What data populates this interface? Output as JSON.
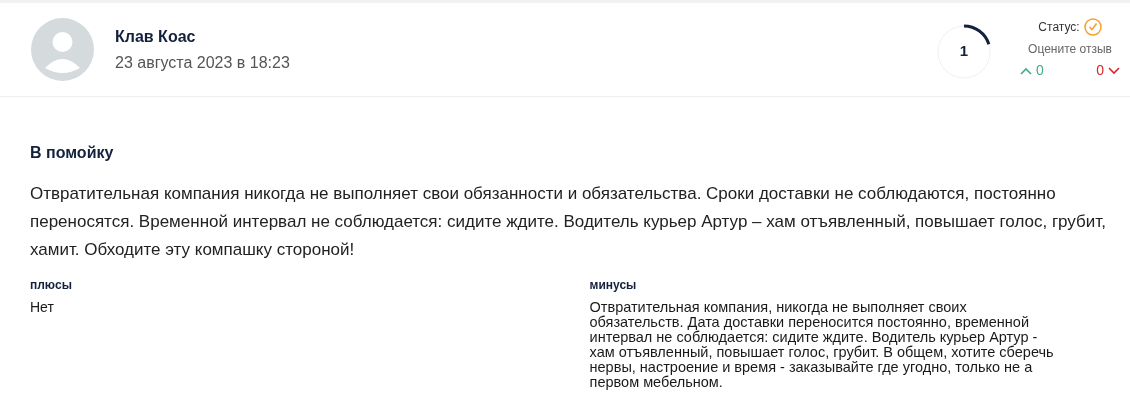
{
  "author": {
    "name": "Клав Коас",
    "date": "23 августа 2023 в 18:23"
  },
  "rating": {
    "value": "1",
    "level": 0.2
  },
  "status": {
    "label": "Статус:",
    "verified": true
  },
  "vote": {
    "prompt": "Оцените отзыв",
    "likes": "0",
    "dislikes": "0"
  },
  "review": {
    "title": "В помойку",
    "text": "Отвратительная компания никогда не выполняет свои обязанности и обязательства. Сроки доставки не соблюдаются, постоянно переносятся. Временной интервал не соблюдается: сидите ждите. Водитель курьер Артур – хам отъявленный, повышает голос, грубит, хамит. Обходите эту компашку стороной!"
  },
  "pros": {
    "heading": "плюсы",
    "text": "Нет"
  },
  "cons": {
    "heading": "минусы",
    "text": "Отвратительная компания, никогда не выполняет своих обязательств. Дата доставки переносится постоянно, временной интервал не соблюдается: сидите ждите. Водитель курьер Артур - хам отъявленный, повышает голос, грубит. В общем, хотите сберечь нервы, настроение и время - заказывайте где угодно, только не а первом мебельном."
  }
}
